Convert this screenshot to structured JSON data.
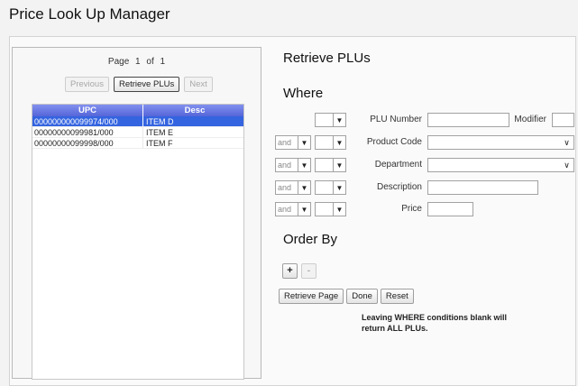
{
  "window": {
    "title": "Price Look Up Manager"
  },
  "pager": {
    "page_label": "Page",
    "page_current": "1",
    "of_label": "of",
    "page_total": "1"
  },
  "nav": {
    "previous": "Previous",
    "retrieve": "Retrieve PLUs",
    "next": "Next"
  },
  "grid": {
    "columns": [
      "UPC",
      "Desc"
    ],
    "rows": [
      {
        "upc": "000000000099974/000",
        "desc": "ITEM D",
        "selected": true
      },
      {
        "upc": "00000000099981/000",
        "desc": "ITEM E",
        "selected": false
      },
      {
        "upc": "00000000099998/000",
        "desc": "ITEM F",
        "selected": false
      }
    ]
  },
  "retrieve": {
    "title": "Retrieve PLUs",
    "where_title": "Where",
    "conditions": [
      {
        "connector": "",
        "field": "PLU Number"
      },
      {
        "connector": "and",
        "field": "Product Code"
      },
      {
        "connector": "and",
        "field": "Department"
      },
      {
        "connector": "and",
        "field": "Description"
      },
      {
        "connector": "and",
        "field": "Price"
      }
    ],
    "modifier_label": "Modifier",
    "order_by_title": "Order By",
    "add_symbol": "+",
    "remove_symbol": "-",
    "buttons": {
      "retrieve_page": "Retrieve Page",
      "done": "Done",
      "reset": "Reset"
    },
    "note": "Leaving WHERE conditions blank will return ALL PLUs."
  },
  "icons": {
    "dropdown": "chevron-down-icon"
  },
  "colors": {
    "grid_header": "#5565d8",
    "selection": "#3464e0"
  }
}
